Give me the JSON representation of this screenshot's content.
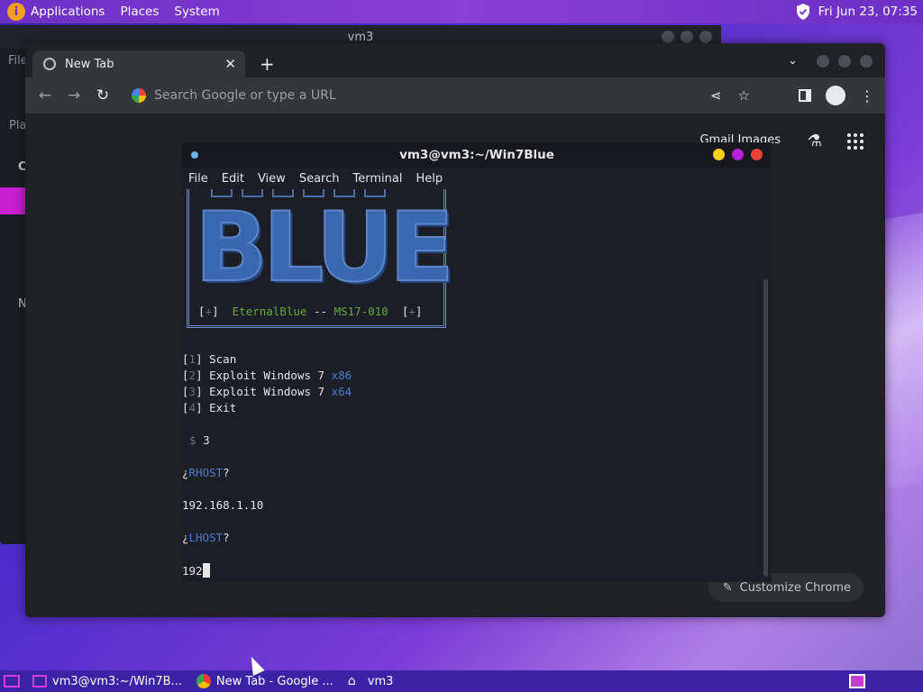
{
  "top_panel": {
    "applications": "Applications",
    "places": "Places",
    "system": "System",
    "datetime": "Fri Jun 23, 07:35"
  },
  "bg_window": {
    "title": "vm3",
    "file": "File",
    "pla": "Pla",
    "c": "C",
    "n": "N"
  },
  "chrome": {
    "tab_title": "New Tab",
    "omnibox_placeholder": "Search Google or type a URL",
    "ntp_links": "Gmail  Images",
    "customize": "Customize Chrome"
  },
  "terminal": {
    "title": "vm3@vm3:~/Win7Blue",
    "menu": [
      "File",
      "Edit",
      "View",
      "Search",
      "Terminal",
      "Help"
    ],
    "banner_text": "BLUE",
    "banner_open": "[",
    "banner_plus": "+",
    "banner_close": "]",
    "banner_name": "EternalBlue",
    "banner_sep": "--",
    "banner_ms": "MS17-010",
    "options": [
      {
        "num": "1",
        "label": "Scan",
        "arch": ""
      },
      {
        "num": "2",
        "label": "Exploit Windows 7",
        "arch": "x86"
      },
      {
        "num": "3",
        "label": "Exploit Windows 7",
        "arch": "x64"
      },
      {
        "num": "4",
        "label": "Exit",
        "arch": ""
      }
    ],
    "prompt_symbol": "$",
    "prompt_input": "3",
    "q_open": "¿",
    "q_close": "?",
    "rhost_label": "RHOST",
    "rhost_value": "192.168.1.10",
    "lhost_label": "LHOST",
    "lhost_partial": "192"
  },
  "taskbar": {
    "task1": "vm3@vm3:~/Win7B...",
    "task2": "New Tab - Google ...",
    "task3": "vm3"
  }
}
